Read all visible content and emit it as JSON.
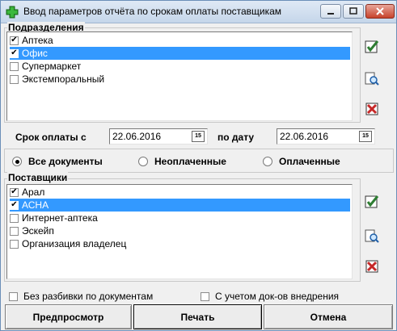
{
  "window": {
    "title": "Ввод параметров отчёта по срокам оплаты поставщикам",
    "app_icon": "green-plus-icon"
  },
  "departments": {
    "label": "Подразделения",
    "items": [
      {
        "label": "Аптека",
        "checked": true,
        "selected": false
      },
      {
        "label": "Офис",
        "checked": true,
        "selected": true
      },
      {
        "label": "Супермаркет",
        "checked": false,
        "selected": false
      },
      {
        "label": "Экстемпоральный",
        "checked": false,
        "selected": false
      }
    ]
  },
  "period": {
    "from_label": "Срок оплаты с",
    "from_value": "22.06.2016",
    "to_label": "по дату",
    "to_value": "22.06.2016",
    "calendar_icon_text": "15"
  },
  "doc_filter": {
    "options": [
      {
        "label": "Все документы",
        "selected": true
      },
      {
        "label": "Неоплаченные",
        "selected": false
      },
      {
        "label": "Оплаченные",
        "selected": false
      }
    ]
  },
  "suppliers": {
    "label": "Поставщики",
    "items": [
      {
        "label": "Арал",
        "checked": true,
        "selected": false
      },
      {
        "label": "АСНА",
        "checked": true,
        "selected": true
      },
      {
        "label": "Интернет-аптека",
        "checked": false,
        "selected": false
      },
      {
        "label": "Эскейп",
        "checked": false,
        "selected": false
      },
      {
        "label": "Организация владелец",
        "checked": false,
        "selected": false
      }
    ]
  },
  "options": {
    "no_breakdown": {
      "label": "Без разбивки по документам",
      "checked": false
    },
    "with_impl_docs": {
      "label": "С учетом док-ов внедрения",
      "checked": false
    }
  },
  "buttons": {
    "preview": "Предпросмотр",
    "print": "Печать",
    "cancel": "Отмена"
  },
  "colors": {
    "selection": "#3399ff",
    "check_all_icon": "#2e7d32",
    "clear_icon": "#c62828"
  }
}
